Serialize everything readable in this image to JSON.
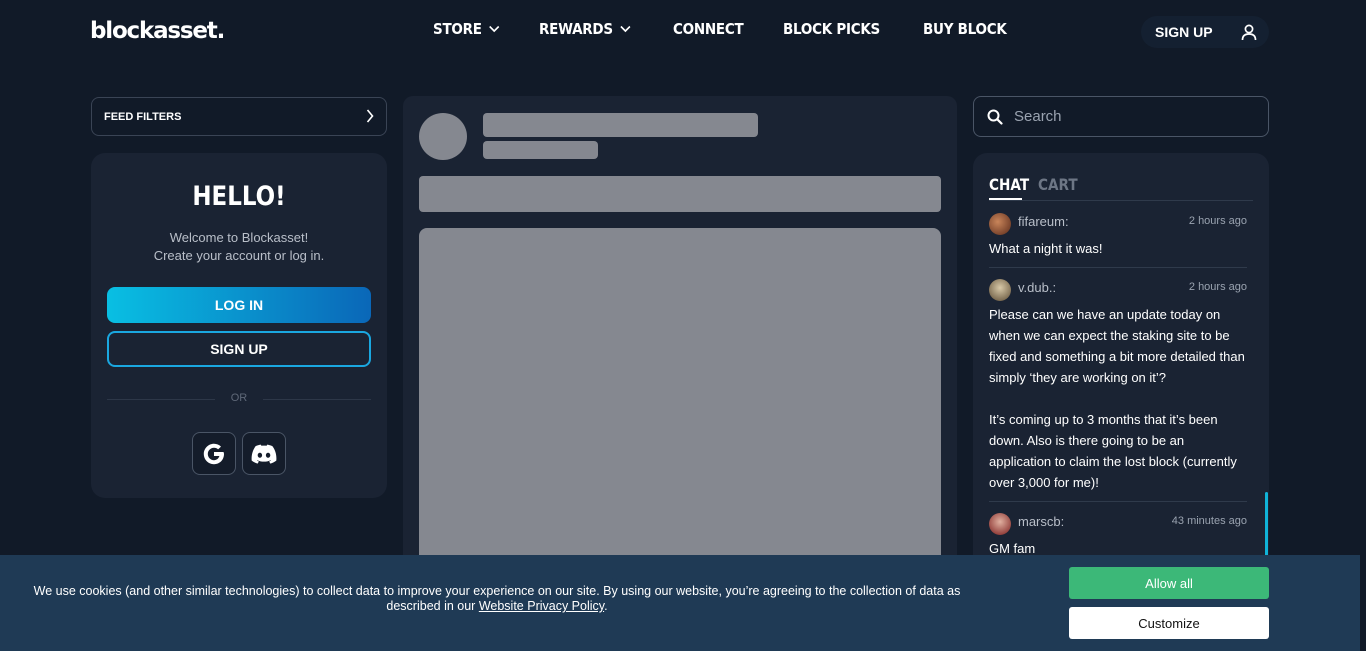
{
  "header": {
    "logo": "blockasset.",
    "nav": [
      {
        "label": "STORE",
        "has_dropdown": true
      },
      {
        "label": "REWARDS",
        "has_dropdown": true
      },
      {
        "label": "CONNECT",
        "has_dropdown": false
      },
      {
        "label": "BLOCK PICKS",
        "has_dropdown": false
      },
      {
        "label": "BUY BLOCK",
        "has_dropdown": false
      }
    ],
    "signup_label": "SIGN UP",
    "user_icon": "user-icon"
  },
  "left": {
    "feed_filters_label": "FEED FILTERS",
    "hello_title": "HELLO!",
    "welcome_line1": "Welcome to Blockasset!",
    "welcome_line2": "Create your account or log in.",
    "login_label": "LOG IN",
    "signup_label": "SIGN UP",
    "or_label": "OR",
    "social": [
      {
        "icon": "google-icon"
      },
      {
        "icon": "discord-icon"
      }
    ]
  },
  "right": {
    "search_placeholder": "Search",
    "tabs": [
      "CHAT",
      "CART"
    ],
    "active_tab": "CHAT",
    "messages": [
      {
        "author": "fifareum:",
        "time": "2 hours ago",
        "text": "What a night it was!"
      },
      {
        "author": "v.dub.:",
        "time": "2 hours ago",
        "text": "Please can we have an update today on when we can expect the staking site to be fixed and something a bit more detailed than simply ‘they are working on it’?\n\nIt’s coming up to 3 months that it’s been down. Also is there going to be an application to claim the lost block (currently over 3,000 for me)!"
      },
      {
        "author": "marscb:",
        "time": "43 minutes ago",
        "text": "GM fam"
      }
    ]
  },
  "cookie": {
    "text_before": "We use cookies (and other similar technologies) to collect data to improve your experience on our site. By using our website, you’re agreeing to the collection of data as described in our ",
    "link_text": "Website Privacy Policy",
    "text_after": ".",
    "allow_label": "Allow all",
    "customize_label": "Customize"
  },
  "colors": {
    "background": "#111a28",
    "card": "#1a2333",
    "accent_cyan": "#09bfe3",
    "accent_blue": "#0a67b8",
    "allow_green": "#3cb878",
    "cookie_bg": "#1f3a55"
  }
}
